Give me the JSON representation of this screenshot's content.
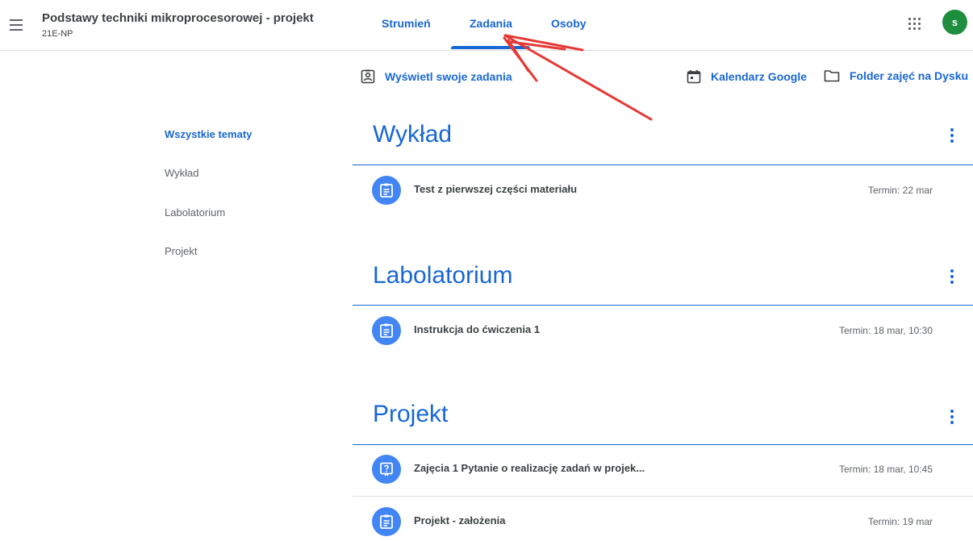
{
  "header": {
    "class_title": "Podstawy techniki mikroprocesorowej - projekt",
    "class_section": "21E-NP",
    "tabs": [
      {
        "label": "Strumień"
      },
      {
        "label": "Zadania"
      },
      {
        "label": "Osoby"
      }
    ],
    "active_tab": "Zadania",
    "avatar_letter": "s",
    "colors": {
      "accent": "#1967d2",
      "avatar": "#1e8e3e",
      "annotation_arrow": "#e53935"
    }
  },
  "actions": {
    "view_your_work": "Wyświetl swoje zadania",
    "google_calendar": "Kalendarz Google",
    "drive_folder": "Folder zajęć na Dysku"
  },
  "topics_nav": [
    {
      "label": "Wszystkie tematy"
    },
    {
      "label": "Wykład"
    },
    {
      "label": "Labolatorium"
    },
    {
      "label": "Projekt"
    }
  ],
  "sections": [
    {
      "title": "Wykład",
      "items": [
        {
          "title": "Test z pierwszej części materiału",
          "due": "Termin: 22 mar",
          "icon": "assignment-icon"
        }
      ]
    },
    {
      "title": "Labolatorium",
      "items": [
        {
          "title": "Instrukcja do ćwiczenia 1",
          "due": "Termin: 18 mar, 10:30",
          "icon": "assignment-icon"
        }
      ]
    },
    {
      "title": "Projekt",
      "items": [
        {
          "title": "Zajęcia 1 Pytanie o realizację zadań w projek...",
          "due": "Termin: 18 mar, 10:45",
          "icon": "question-icon"
        },
        {
          "title": "Projekt - założenia",
          "due": "Termin: 19 mar",
          "icon": "assignment-icon"
        }
      ]
    }
  ]
}
